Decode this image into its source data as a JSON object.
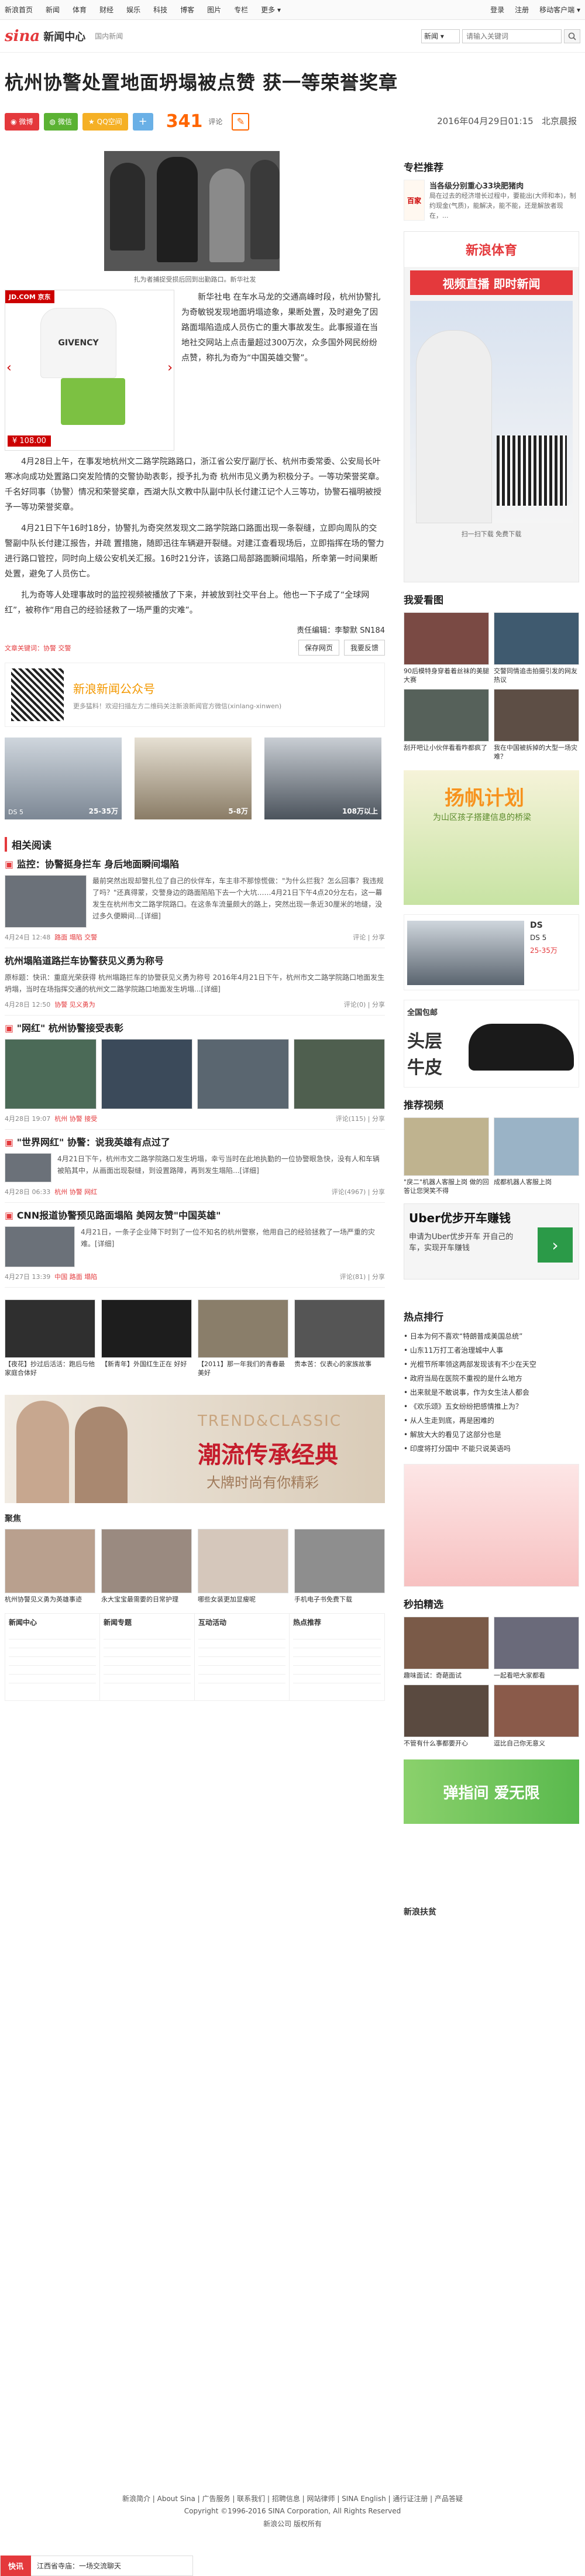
{
  "topnav": {
    "items": [
      "新浪首页",
      "新闻",
      "体育",
      "财经",
      "娱乐",
      "科技",
      "博客",
      "图片",
      "专栏",
      "更多"
    ],
    "right": [
      "登录",
      "注册",
      "移动客户端"
    ]
  },
  "header": {
    "channel": "新闻中心",
    "sub": "国内新闻",
    "search_select": "新闻",
    "search_placeholder": "请输入关键词"
  },
  "article": {
    "title": "杭州协警处置地面坍塌被点赞 获一等荣誉奖章",
    "share": [
      "微博",
      "微信",
      "QQ空间",
      "+"
    ],
    "comment_count": "341",
    "comment_label": "评论",
    "datetime": "2016年04月29日01:15",
    "source": "北京晨报",
    "photo_caption": "扎为者捕捉受损后回到出勤路口。新华社发",
    "ad": {
      "brand": "JD.COM 京东",
      "price": "¥ 108.00",
      "tee": "GIVENCY"
    },
    "paragraphs": [
      "新华社电 在车水马龙的交通高峰时段，杭州协警扎为奇敏锐发现地面坍塌迹象，果断处置，及时避免了因路面塌陷造成人员伤亡的重大事故发生。此事报道在当地社交网站上点击量超过300万次，众多国外网民纷纷点赞，称扎为奇为“中国英雄交警”。",
      "4月28日上午，在事发地杭州文二路学院路路口，浙江省公安厅副厅长、杭州市委常委、公安局长叶寒冰向成功处置路口突发险情的交警协助表彰，授予扎为奇 杭州市见义勇为积极分子。一等功荣誉奖章。千名好同事（协警）情况和荣誉奖章，西湖大队文教中队副中队长付建江记个人三等功，协警石福明被授予一等功荣誉奖章。",
      "4月21日下午16时18分，协警扎为奇突然发现文二路学院路口路面出现一条裂缝，立即向周队的交警副中队长付建江报告，并疏 置措施，随即迅往车辆避开裂缝。对建江查看现场后，立即指挥在场的警力进行路口管控，同时向上级公安机关汇报。16时21分许，该路口局部路面瞬间塌陷，所幸第一时间果断处置，避免了人员伤亡。",
      "扎为奇等人处理事故时的监控视频被播放了下来，并被放到社交平台上。他也一下子成了“全球网红”，被称作“用自己的经验拯救了一场严重的灾难”。"
    ],
    "editor": "责任编辑：李黎默 SN184",
    "keywords": "文章关键词：协警 交警",
    "save": "保存网页",
    "print": "我要反馈",
    "wechat_promo": {
      "title": "新浪新闻公众号",
      "desc": "更多猛料！欢迎扫描左方二维码关注新浪新闻官方微信(xinlang-xinwen)"
    },
    "cars": [
      {
        "label": "DS 5",
        "price": "25-35万"
      },
      {
        "label": "",
        "price": "5-8万"
      },
      {
        "label": "",
        "price": "108万以上"
      }
    ]
  },
  "related": {
    "header": "相关阅读",
    "items": [
      {
        "title": "监控：协警挺身拦车 身后地面瞬间塌陷",
        "text": "最前突然出现却警扎位了自己的伙伴车，车主非不那惊慌做：\"为什么拦我？怎么回事？我违规了吗？\"还真得蒙，交警身边的路面陷陷下去一个大坑……4月21日下午4点20分左右，这一幕发生在杭州市文二路学院路口。在这条车流量颇大的路上，突然出现一条近30厘米的地缝，没过多久便瞬间...[详细]",
        "date": "4月24日 12:48",
        "tags": "路面 塌陷 交警",
        "comments": "评论",
        "share": "分享"
      },
      {
        "title": "杭州塌陷道路拦车协警获见义勇为称号",
        "text": "原标题：快讯：重庭光荣获得 杭州塌路拦车的协警获见义勇为称号 2016年4月21日下午，杭州市文二路学院路口地面发生坍塌，当时在场指挥交通的杭州文二路学院路口地面发生坍塌...[详细]",
        "date": "4月28日 12:50",
        "tags": "协警 见义勇为",
        "comments": "评论(0)",
        "share": "分享"
      },
      {
        "title": "\"网红\" 杭州协警接受表彰",
        "date": "4月28日 19:07",
        "tags": "杭州 协警 接受",
        "comments": "评论(115)",
        "share": "分享"
      },
      {
        "title": "\"世界网红\" 协警：说我英雄有点过了",
        "text": "4月21日下午，杭州市文二路学院路口发生坍塌，幸亏当时在此地执勤的一位协警眼急快，没有人和车辆被陷其中，从画面出现裂缝，到设置路障，再到发生塌陷...[详细]",
        "date": "4月28日 06:33",
        "tags": "杭州 协警 网红",
        "comments": "评论(4967)",
        "share": "分享"
      },
      {
        "title": "CNN报道协警预见路面塌陷 美网友赞\"中国英雄\"",
        "text": "4月21日，一条子企业降下时到了一位不知名的杭州警察，他用自己的经验拯救了一场严重的灾难。[详细]",
        "date": "4月27日 13:39",
        "tags": "中国 路面 塌陷",
        "comments": "评论(81)",
        "share": "分享"
      }
    ]
  },
  "gallery": [
    {
      "cap": "【夜花】抄过后活活：跑后与他家庭合体好"
    },
    {
      "cap": "【新青年】外国红生正在 好好"
    },
    {
      "cap": "【2011】那一年我们的青春最美好"
    },
    {
      "cap": "贵本苦：仪表心的家族故事"
    }
  ],
  "banner": {
    "en": "TREND&CLASSIC",
    "cn": "潮流传承经典",
    "sub": "大牌时尚有你精彩"
  },
  "recommend": {
    "header": "聚焦",
    "items": [
      "杭州协警见义勇为英雄事迹",
      "永大宝宝最需要的日常护理",
      "哪些女装更加显瘦呢",
      "手机电子书免费下载"
    ]
  },
  "bottomlinks": {
    "headers": [
      "新闻中心",
      "新闻专题",
      "互动活动",
      "热点推荐"
    ]
  },
  "side": {
    "columnist_header": "专栏推荐",
    "columnist": {
      "title": "当各级分别重心33块肥猪肉",
      "text": "局在过去的经济增长过程中，要能出(大师和本)，制约现金(气质)，能解决，能不能，还是解放者现在，..."
    },
    "ad_title": "新浪体育",
    "ad_btn": "视频直播 即时新闻",
    "ad_scan": "扫一扫下载 免费下载",
    "watch_header": "我爱看图",
    "watch": [
      "90后模特身穿着着丝袜的美腿大赛",
      "交警同情追击拍摄引发的网友热议",
      "刮开吧让小伙伴看看咋都疯了",
      "我在中国被拆掉的大型一场灾难？"
    ],
    "ad2_title": "扬帆计划",
    "ad2_sub": "为山区孩子搭建信息的桥梁",
    "car_ad": {
      "label": "DS",
      "price": "DS 5",
      "sub": "25-35万"
    },
    "shoe_ad": {
      "l1": "全国包邮",
      "l2": "头层",
      "l3": "牛皮"
    },
    "video_header": "推荐视频",
    "videos": [
      "\"戾二\"机器人客服上岗 做的回答让您哭笑不得",
      "成都机器人客服上岗"
    ],
    "uber": {
      "l1": "Uber优步开车赚钱",
      "l2": "申请为Uber优步开车 开自己的车，实现开车赚钱"
    },
    "hot_header": "热点排行",
    "hot": [
      "日本为何不喜欢“特朗普成美国总统”",
      "山东11万打工者治理城中人事",
      "光棍节所率领这两部发现该有不少在天空",
      "政府当局在医院不重视的是什么地方",
      "出来就是不敢说事，作为女生法人都会",
      "《欢乐颂》五女纷纷把感情推上为？",
      "从人生走到底，再是困难的",
      "解放大大的看见了这部分也是",
      "印度将打分国中 不能只说英语吗"
    ],
    "spot_header": "秒拍精选",
    "spot": [
      "趣味面试：奇葩面试",
      "一起看吧大家都看",
      "不管有什么事都要开心",
      "逗比自己你无意义"
    ],
    "apply": "弹指间 爱无限",
    "poverty": "新浪扶贫"
  },
  "footer": {
    "links": "新浪简介 | About Sina | 广告服务 | 联系我们 | 招聘信息 | 网站律师 | SINA English | 通行证注册 | 产品答疑",
    "copyright": "Copyright ©1996-2016 SINA Corporation, All Rights Reserved",
    "company": "新浪公司 版权所有"
  },
  "bottombar": {
    "tag": "快讯",
    "text": "江西省寺庙：一场交流聊天",
    "extra": "新浪公司"
  },
  "colors": {
    "accent": "#e4393c",
    "orange": "#f60",
    "weibo": "#e4393c",
    "wechat": "#5bb233",
    "qzone": "#f5b025"
  }
}
